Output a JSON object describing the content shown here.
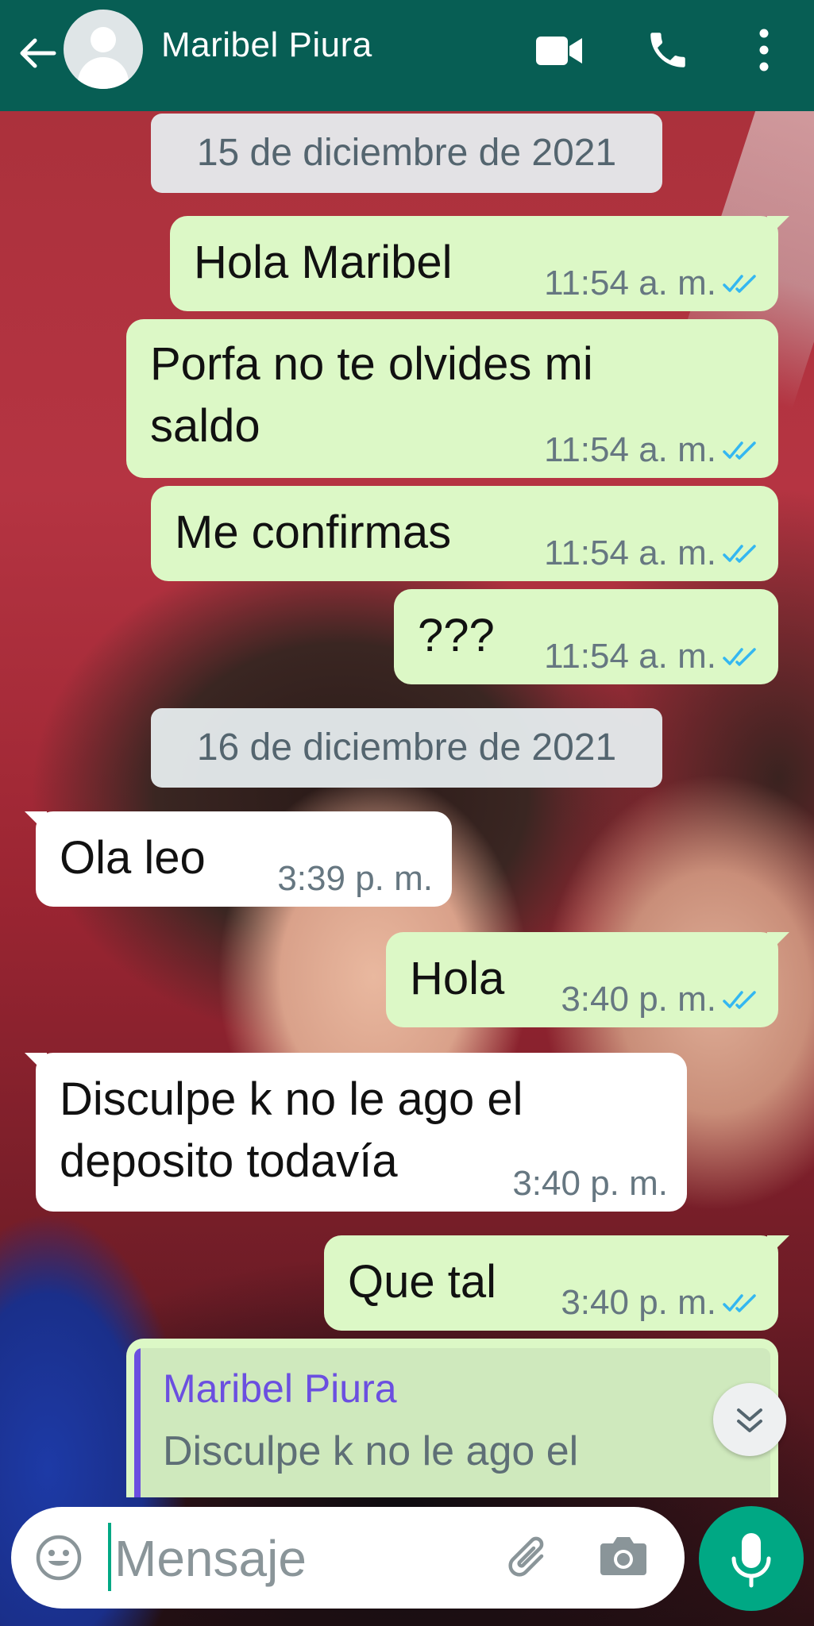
{
  "header": {
    "contact_name": "Maribel Piura",
    "icons": [
      "back-arrow-icon",
      "avatar-icon",
      "video-call-icon",
      "phone-icon",
      "more-options-icon"
    ]
  },
  "messages": [
    {
      "type": "date",
      "text": "15 de diciembre de 2021"
    },
    {
      "type": "outgoing",
      "text": "Hola Maribel",
      "time": "11:54 a. m.",
      "status": "read"
    },
    {
      "type": "outgoing",
      "text": "Porfa no te olvides mi\nsaldo",
      "time": "11:54 a. m.",
      "status": "read"
    },
    {
      "type": "outgoing",
      "text": "Me confirmas",
      "time": "11:54 a. m.",
      "status": "read"
    },
    {
      "type": "outgoing",
      "text": "???",
      "time": "11:54 a. m.",
      "status": "read"
    },
    {
      "type": "date",
      "text": "16 de diciembre de 2021"
    },
    {
      "type": "incoming",
      "text": "Ola leo",
      "time": "3:39 p. m."
    },
    {
      "type": "outgoing",
      "text": "Hola",
      "time": "3:40 p. m.",
      "status": "read"
    },
    {
      "type": "incoming",
      "text": "Disculpe k no le ago el\ndeposito todavía",
      "time": "3:40 p. m."
    },
    {
      "type": "outgoing",
      "text": "Que tal",
      "time": "3:40 p. m.",
      "status": "read"
    },
    {
      "type": "outgoing-reply",
      "quoted_name": "Maribel Piura",
      "quoted_text": "Disculpe k no le ago el"
    }
  ],
  "composer": {
    "placeholder": "Mensaje",
    "icons": [
      "emoji-icon",
      "attach-icon",
      "camera-icon",
      "mic-icon"
    ]
  },
  "colors": {
    "header": "#075e54",
    "outgoing_bubble": "#dcf8c6",
    "incoming_bubble": "#ffffff",
    "accent": "#00a884",
    "read_ticks": "#34b7f1",
    "quote_name": "#6b4fe0"
  }
}
